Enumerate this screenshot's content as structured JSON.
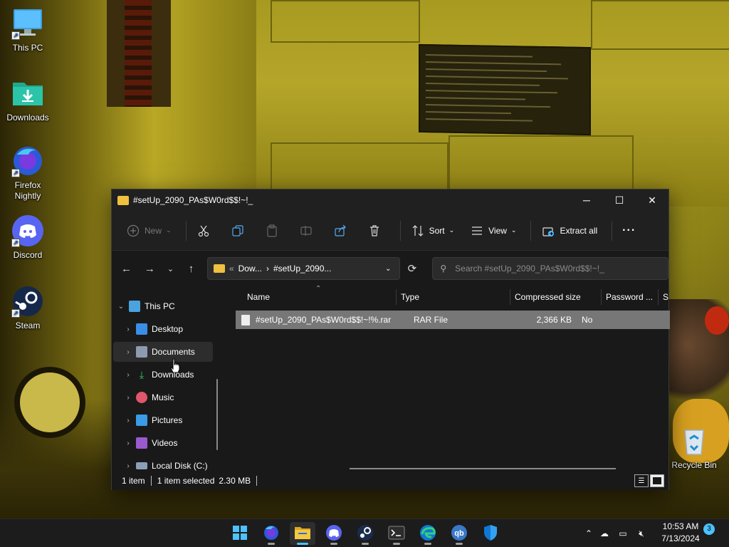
{
  "desktop": {
    "icons": [
      {
        "label": "This PC",
        "icon": "this-pc-icon"
      },
      {
        "label": "Downloads",
        "icon": "downloads-folder-icon"
      },
      {
        "label": "Firefox Nightly",
        "icon": "firefox-nightly-icon"
      },
      {
        "label": "Discord",
        "icon": "discord-icon"
      },
      {
        "label": "Steam",
        "icon": "steam-icon"
      },
      {
        "label": "Recycle Bin",
        "icon": "recycle-bin-icon"
      }
    ]
  },
  "window": {
    "title": "#setUp_2090_PAs$W0rd$$!~!_",
    "controls": {
      "minimize": "─",
      "maximize": "☐",
      "close": "✕"
    }
  },
  "toolbar": {
    "new_label": "New",
    "sort_label": "Sort",
    "view_label": "View",
    "extract_label": "Extract all",
    "more_label": "···"
  },
  "address": {
    "crumb_root": "Dow...",
    "crumb_current": "#setUp_2090...",
    "search_placeholder": "Search #setUp_2090_PAs$W0rd$$!~!_"
  },
  "nav": {
    "items": [
      {
        "label": "This PC",
        "icon": "this-pc-icon",
        "color": "#4aa3df"
      },
      {
        "label": "Desktop",
        "icon": "desktop-icon",
        "color": "#3a8ee6"
      },
      {
        "label": "Documents",
        "icon": "documents-icon",
        "color": "#8c9bb0"
      },
      {
        "label": "Downloads",
        "icon": "downloads-icon",
        "color": "#3ec46d"
      },
      {
        "label": "Music",
        "icon": "music-icon",
        "color": "#e0566a"
      },
      {
        "label": "Pictures",
        "icon": "pictures-icon",
        "color": "#3a9be6"
      },
      {
        "label": "Videos",
        "icon": "videos-icon",
        "color": "#9b59d0"
      },
      {
        "label": "Local Disk (C:)",
        "icon": "local-disk-icon",
        "color": "#8aa0b8"
      }
    ]
  },
  "table": {
    "columns": [
      "Name",
      "Type",
      "Compressed size",
      "Password ...",
      "Si"
    ],
    "rows": [
      {
        "name": "#setUp_2090_PAs$W0rd$$!~!%.rar",
        "type": "RAR File",
        "size": "2,366 KB",
        "password": "No"
      }
    ]
  },
  "status": {
    "count": "1 item",
    "selected": "1 item selected",
    "size": "2.30 MB"
  },
  "taskbar": {
    "apps": [
      "start-icon",
      "firefox-nightly-icon",
      "file-explorer-icon",
      "discord-icon",
      "steam-icon",
      "terminal-icon",
      "edge-icon",
      "qbittorrent-icon",
      "defender-icon"
    ],
    "time": "10:53 AM",
    "date": "7/13/2024",
    "notifications": "3"
  },
  "colors": {
    "accent": "#4cc2ff",
    "window_bg": "#191919",
    "selected_row": "#777777"
  }
}
